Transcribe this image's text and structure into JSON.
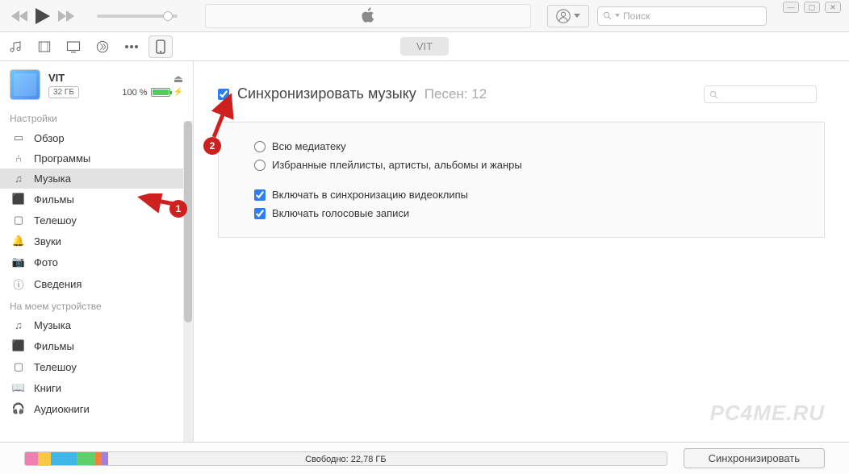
{
  "topbar": {
    "search_placeholder": "Поиск"
  },
  "nav": {
    "device_pill": "VIT"
  },
  "device": {
    "name": "VIT",
    "capacity": "32 ГБ",
    "battery_pct": "100 %"
  },
  "sidebar": {
    "section_settings": "Настройки",
    "section_ondevice": "На моем устройстве",
    "settings": {
      "overview": "Обзор",
      "apps": "Программы",
      "music": "Музыка",
      "movies": "Фильмы",
      "tvshows": "Телешоу",
      "tones": "Звуки",
      "photos": "Фото",
      "info": "Сведения"
    },
    "ondevice": {
      "music": "Музыка",
      "movies": "Фильмы",
      "tvshows": "Телешоу",
      "books": "Книги",
      "audiobooks": "Аудиокниги"
    }
  },
  "main": {
    "sync_title": "Синхронизировать музыку",
    "song_count": "Песен: 12",
    "radio_all": "Всю медиатеку",
    "radio_selected": "Избранные плейлисты, артисты, альбомы и жанры",
    "check_videos": "Включать в синхронизацию видеоклипы",
    "check_voice": "Включать голосовые записи"
  },
  "bottom": {
    "free_label": "Свободно: 22,78 ГБ",
    "sync_button": "Синхронизировать"
  },
  "annotations": {
    "badge1": "1",
    "badge2": "2"
  },
  "watermark": "PC4ME.RU",
  "storage_segments": [
    {
      "color": "#ef7fb0",
      "width": "2%"
    },
    {
      "color": "#f7c845",
      "width": "2%"
    },
    {
      "color": "#3fb8e8",
      "width": "4%"
    },
    {
      "color": "#5fd06a",
      "width": "3%"
    },
    {
      "color": "#f0833c",
      "width": "1%"
    },
    {
      "color": "#a47fe0",
      "width": "1%"
    }
  ]
}
